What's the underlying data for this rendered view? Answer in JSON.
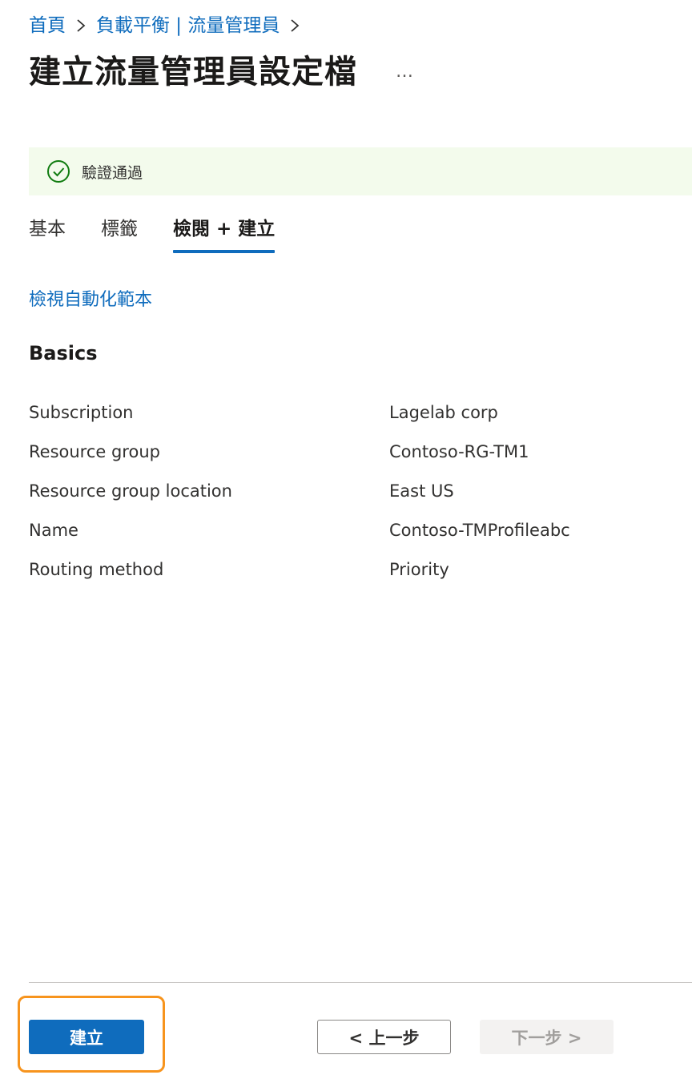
{
  "breadcrumb": {
    "items": [
      "首頁",
      "負載平衡 | 流量管理員"
    ]
  },
  "header": {
    "title": "建立流量管理員設定檔",
    "more_label": "…"
  },
  "validation": {
    "text": "驗證通過",
    "icon": "check-circle-icon",
    "color": "#107c10",
    "background": "#f3fbec"
  },
  "tabs": [
    {
      "label": "基本",
      "active": false
    },
    {
      "label": "標籤",
      "active": false
    },
    {
      "label": "檢閱 + 建立",
      "active": true
    }
  ],
  "template_link": "檢視自動化範本",
  "section": {
    "heading": "Basics",
    "rows": [
      {
        "label": "Subscription",
        "value": "Lagelab corp"
      },
      {
        "label": "Resource group",
        "value": "Contoso-RG-TM1"
      },
      {
        "label": "Resource group location",
        "value": "East US"
      },
      {
        "label": "Name",
        "value": "Contoso-TMProfileabc"
      },
      {
        "label": "Routing method",
        "value": "Priority"
      }
    ]
  },
  "footer": {
    "create_label": "建立",
    "prev_label": "< 上一步",
    "next_label": "下一步 >",
    "accent_color": "#0f6cbd",
    "highlight_color": "#f7941d"
  }
}
